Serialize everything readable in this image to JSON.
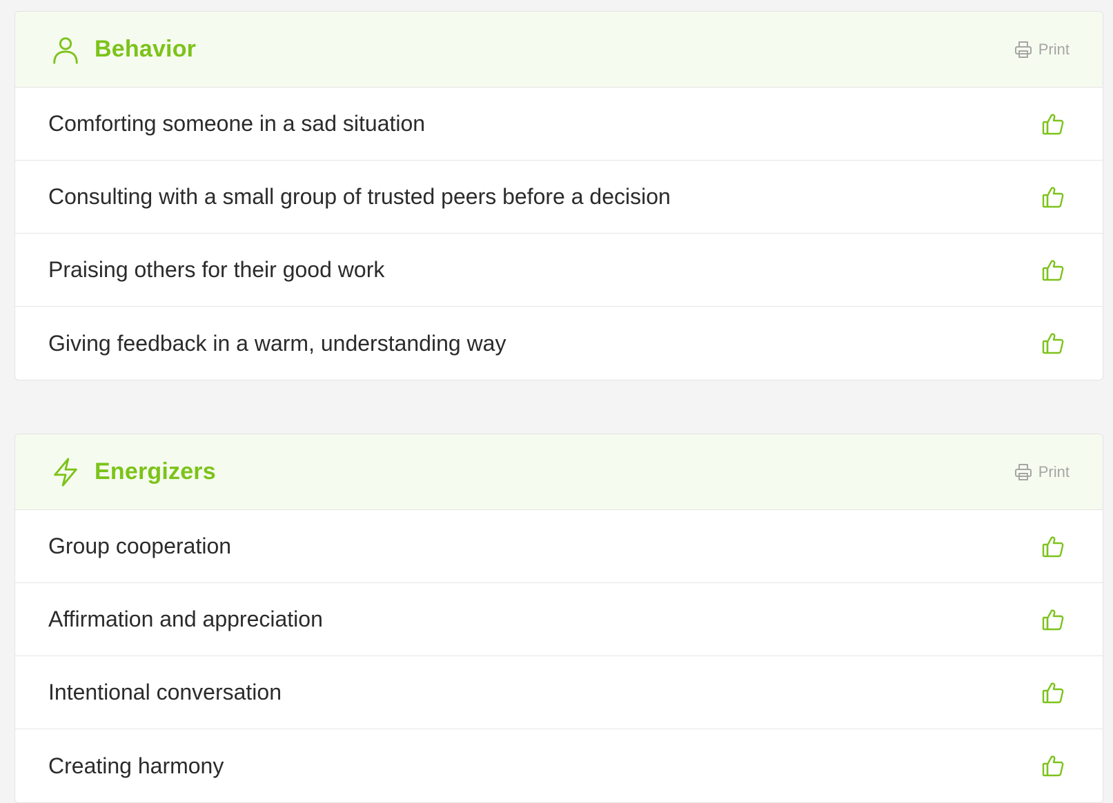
{
  "colors": {
    "accent": "#7cc31a",
    "header_bg": "#f6fbef",
    "page_bg": "#f4f4f4",
    "muted": "#a5a5a5"
  },
  "sections": [
    {
      "title": "Behavior",
      "icon": "person-icon",
      "print_label": "Print",
      "items": [
        {
          "label": "Comforting someone in a sad situation"
        },
        {
          "label": "Consulting with a small group of trusted peers before a decision"
        },
        {
          "label": "Praising others for their good work"
        },
        {
          "label": "Giving feedback in a warm, understanding way"
        }
      ]
    },
    {
      "title": "Energizers",
      "icon": "lightning-icon",
      "print_label": "Print",
      "items": [
        {
          "label": "Group cooperation"
        },
        {
          "label": "Affirmation and appreciation"
        },
        {
          "label": "Intentional conversation"
        },
        {
          "label": "Creating harmony"
        }
      ]
    }
  ]
}
